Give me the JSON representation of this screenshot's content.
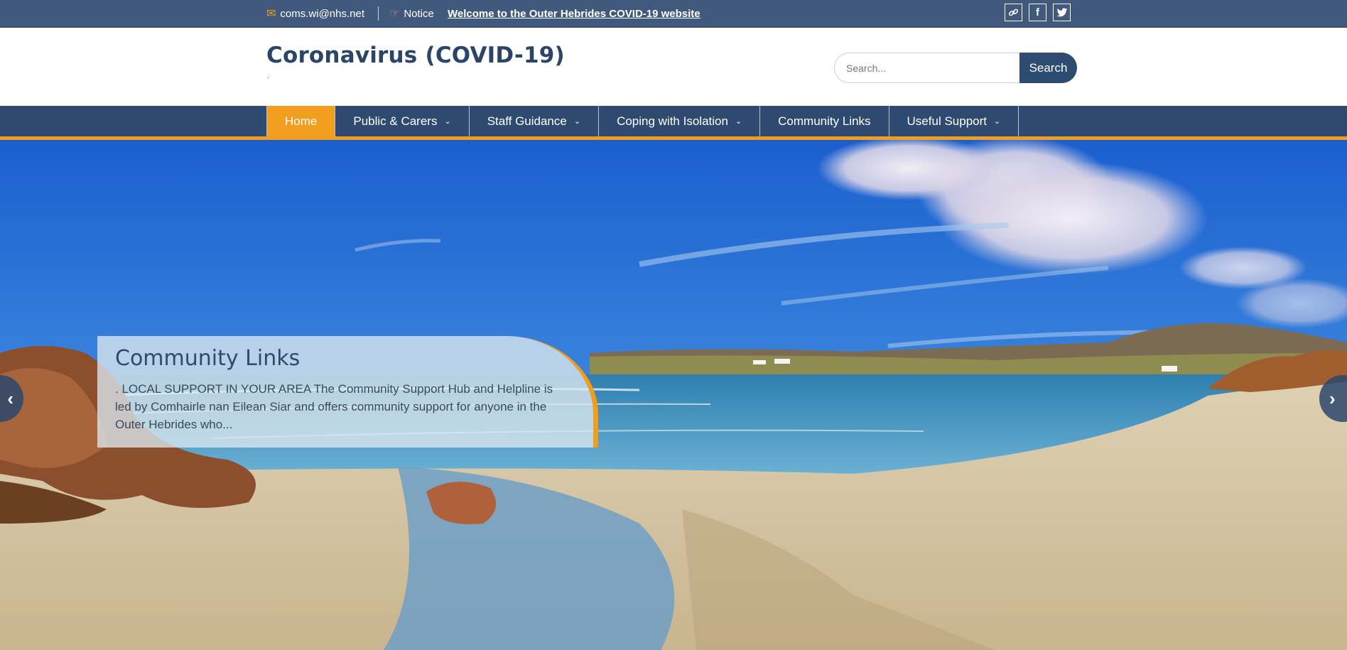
{
  "topbar": {
    "email": "coms.wi@nhs.net",
    "notice_label": "Notice",
    "welcome_link": "Welcome to the Outer Hebrides COVID-19 website",
    "icons": [
      "envelope-icon",
      "hand-pointer-icon",
      "link-icon",
      "facebook-icon",
      "twitter-icon"
    ]
  },
  "header": {
    "site_title": "Coronavirus (COVID-19)",
    "site_description": ".",
    "search": {
      "placeholder": "Search...",
      "button_label": "Search"
    }
  },
  "nav": {
    "items": [
      {
        "label": "Home",
        "active": true,
        "has_submenu": false
      },
      {
        "label": "Public & Carers",
        "active": false,
        "has_submenu": true
      },
      {
        "label": "Staff Guidance",
        "active": false,
        "has_submenu": true
      },
      {
        "label": "Coping with Isolation",
        "active": false,
        "has_submenu": true
      },
      {
        "label": "Community Links",
        "active": false,
        "has_submenu": false
      },
      {
        "label": "Useful Support",
        "active": false,
        "has_submenu": true
      }
    ]
  },
  "slider": {
    "title": "Community Links",
    "excerpt": ". LOCAL SUPPORT IN YOUR AREA The Community Support Hub and Helpline is led by Comhairle nan Eilean Siar and offers community support for anyone in the Outer Hebrides who...",
    "prev_label": "‹",
    "next_label": "›"
  },
  "colors": {
    "topbar": "#41597c",
    "nav": "#2f4a70",
    "accent": "#f19d1d",
    "title": "#2b4568"
  }
}
